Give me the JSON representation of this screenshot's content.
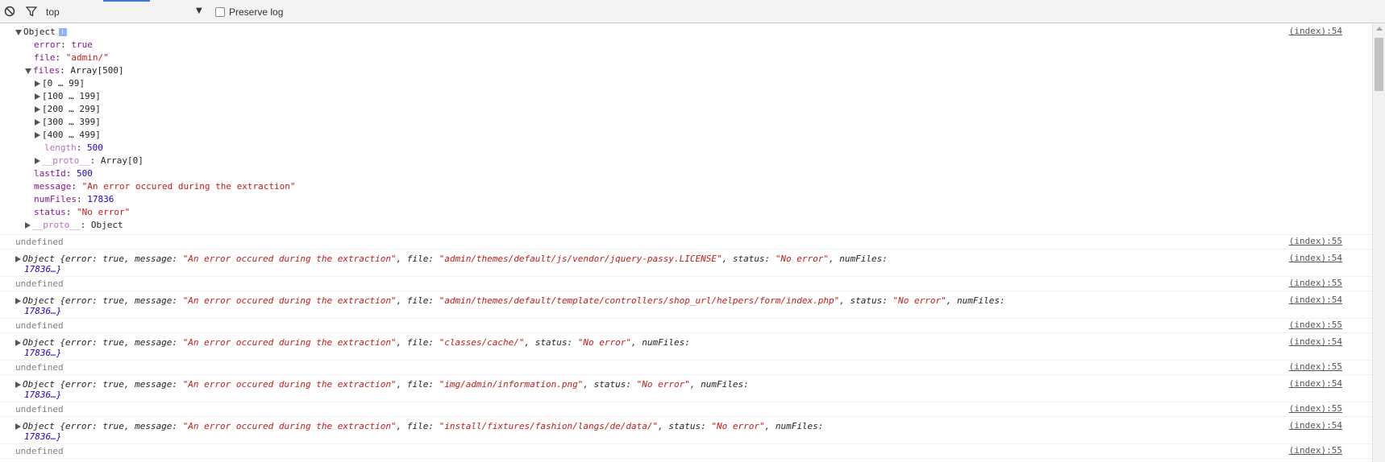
{
  "toolbar": {
    "context": "top",
    "dropdown_arrow": "▼",
    "preserve_log_label": "Preserve log",
    "icons": [
      "clear-console-icon",
      "filter-icon"
    ]
  },
  "object_expanded": {
    "header": "Object",
    "info_badge": "i",
    "source": "(index):54",
    "props": {
      "error_key": "error",
      "error_val": "true",
      "file_key": "file",
      "file_val": "\"admin/\"",
      "files_key": "files",
      "files_val": "Array[500]",
      "ranges": [
        "[0 … 99]",
        "[100 … 199]",
        "[200 … 299]",
        "[300 … 399]",
        "[400 … 499]"
      ],
      "length_key": "length",
      "length_val": "500",
      "proto_arr_key": "__proto__",
      "proto_arr_val": "Array[0]",
      "lastId_key": "lastId",
      "lastId_val": "500",
      "message_key": "message",
      "message_val": "\"An error occured during the extraction\"",
      "numFiles_key": "numFiles",
      "numFiles_val": "17836",
      "status_key": "status",
      "status_val": "\"No error\"",
      "proto_obj_key": "__proto__",
      "proto_obj_val": "Object"
    }
  },
  "log_entries": [
    {
      "undefined": "undefined",
      "undef_src": "(index):55",
      "obj_prefix": "Object {error: true, message: ",
      "msg": "\"An error occured during the extraction\"",
      "file_label": ", file: ",
      "file": "\"admin/themes/default/js/vendor/jquery-passy.LICENSE\"",
      "status_label": ", status: ",
      "status": "\"No error\"",
      "num_label": ", numFiles:",
      "num_cont": "17836…}",
      "obj_src": "(index):54"
    },
    {
      "undefined": "undefined",
      "undef_src": "(index):55",
      "obj_prefix": "Object {error: true, message: ",
      "msg": "\"An error occured during the extraction\"",
      "file_label": ", file: ",
      "file": "\"admin/themes/default/template/controllers/shop_url/helpers/form/index.php\"",
      "status_label": ", status: ",
      "status": "\"No error\"",
      "num_label": ", numFiles:",
      "num_cont": "17836…}",
      "obj_src": "(index):54"
    },
    {
      "undefined": "undefined",
      "undef_src": "(index):55",
      "obj_prefix": "Object {error: true, message: ",
      "msg": "\"An error occured during the extraction\"",
      "file_label": ", file: ",
      "file": "\"classes/cache/\"",
      "status_label": ", status: ",
      "status": "\"No error\"",
      "num_label": ", numFiles:",
      "num_cont": "17836…}",
      "obj_src": "(index):54"
    },
    {
      "undefined": "undefined",
      "undef_src": "(index):55",
      "obj_prefix": "Object {error: true, message: ",
      "msg": "\"An error occured during the extraction\"",
      "file_label": ", file: ",
      "file": "\"img/admin/information.png\"",
      "status_label": ", status: ",
      "status": "\"No error\"",
      "num_label": ", numFiles:",
      "num_cont": "17836…}",
      "obj_src": "(index):54"
    },
    {
      "undefined": "undefined",
      "undef_src": "(index):55",
      "obj_prefix": "Object {error: true, message: ",
      "msg": "\"An error occured during the extraction\"",
      "file_label": ", file: ",
      "file": "\"install/fixtures/fashion/langs/de/data/\"",
      "status_label": ", status: ",
      "status": "\"No error\"",
      "num_label": ", numFiles:",
      "num_cont": "17836…}",
      "obj_src": "(index):54"
    }
  ],
  "last_undefined": {
    "text": "undefined",
    "src": "(index):55"
  }
}
